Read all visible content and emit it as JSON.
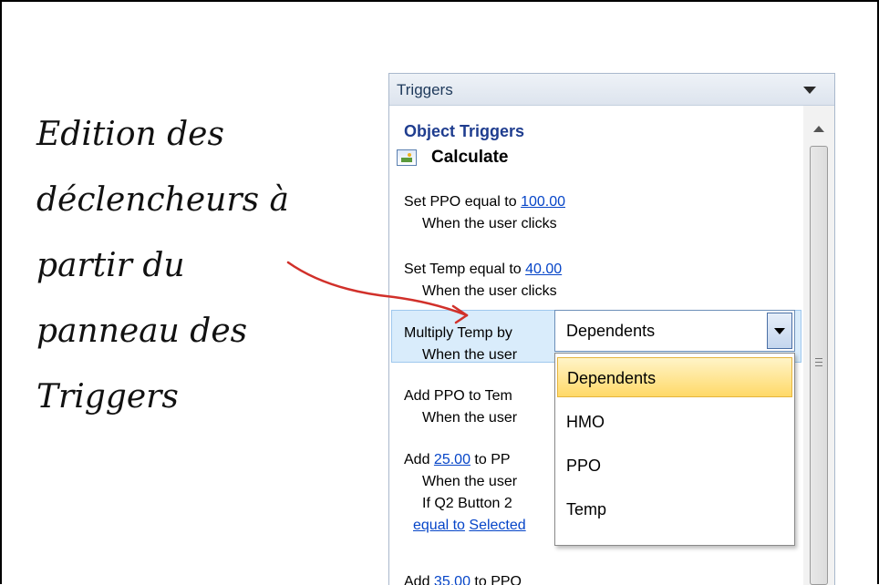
{
  "caption": {
    "lines": [
      "Edition des",
      "déclencheurs à",
      "partir du",
      "panneau des",
      "Triggers"
    ]
  },
  "panel": {
    "title": "Triggers",
    "section_heading": "Object Triggers",
    "object_name": "Calculate",
    "triggers": [
      {
        "prefix": "Set PPO equal to ",
        "value": "100.00",
        "when": "When the user clicks"
      },
      {
        "prefix": "Set Temp equal to ",
        "value": "40.00",
        "when": "When the user clicks"
      },
      {
        "prefix": "Multiply Temp by",
        "when": "When the user"
      },
      {
        "prefix": "Add PPO to Tem",
        "when": "When the user"
      },
      {
        "prefix": "Add ",
        "value": "25.00",
        "suffix": " to PP",
        "when": "When the user",
        "condition": "If Q2 Button 2",
        "condition_link1": "equal to",
        "condition_link2": "Selected"
      },
      {
        "prefix": "Add ",
        "value": "35.00",
        "suffix": " to PPO"
      }
    ]
  },
  "dropdown": {
    "selected": "Dependents",
    "options": [
      "Dependents",
      "HMO",
      "PPO",
      "Temp"
    ],
    "highlighted_index": 0
  },
  "colors": {
    "link": "#0645c8",
    "heading": "#1f3d8f",
    "selection": "#d9ecfb",
    "highlight": "#ffd968",
    "annotation_arrow": "#d1302a"
  }
}
